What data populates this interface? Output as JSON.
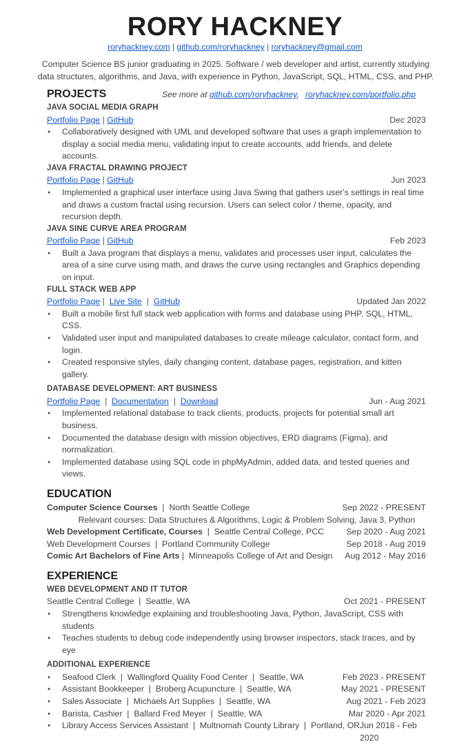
{
  "header": {
    "name": "RORY HACKNEY",
    "links": [
      "roryhackney.com",
      "github.com/roryhackney",
      "roryhackney@gmail.com"
    ],
    "separator": "|",
    "summary_line1": "Computer Science BS junior graduating in 2025. Software / web developer and artist, currently studying",
    "summary_line2": "data structures, algorithms, and Java, with experience in Python, JavaScript, SQL, HTML, CSS, and PHP."
  },
  "projects": {
    "title": "PROJECTS",
    "see_more_label": "See more at",
    "see_more_links": [
      "github.com/roryhackney",
      "roryhackney.com/portfolio.php"
    ],
    "items": [
      {
        "title": "JAVA SOCIAL MEDIA GRAPH",
        "links": [
          "Portfolio Page",
          "GitHub"
        ],
        "date": "Dec 2023",
        "bullets": [
          "Collaboratively designed with UML and developed software that uses a graph implementation to display a social media menu, validating input to create accounts, add friends, and delete accounts."
        ]
      },
      {
        "title": "JAVA FRACTAL DRAWING PROJECT",
        "links": [
          "Portfolio Page",
          "GitHub"
        ],
        "date": "Jun 2023",
        "bullets": [
          "Implemented a graphical user interface using Java Swing that gathers user's settings in real time and draws a custom fractal using recursion. Users can select color / theme, opacity, and recursion depth."
        ]
      },
      {
        "title": "JAVA SINE CURVE AREA PROGRAM",
        "links": [
          "Portfolio Page",
          "GitHub"
        ],
        "date": "Feb 2023",
        "bullets": [
          "Built a Java program that displays a menu, validates and processes user input, calculates the area of a sine curve using math, and draws the curve using rectangles and Graphics depending on input."
        ]
      },
      {
        "title": "FULL STACK WEB APP",
        "links": [
          "Portfolio Page",
          "Live Site",
          "GitHub"
        ],
        "date": "Updated Jan 2022",
        "bullets": [
          "Built a mobile first full stack web application with forms and database using PHP, SQL, HTML, CSS.",
          "Validated user input and manipulated databases to create mileage calculator, contact form, and login.",
          "Created responsive styles, daily changing content, database pages, registration, and kitten gallery."
        ]
      },
      {
        "title": "DATABASE DEVELOPMENT: ART BUSINESS",
        "links": [
          "Portfolio Page",
          "Documentation",
          "Download"
        ],
        "date": "Jun - Aug 2021",
        "bullets": [
          "Implemented relational database to track clients, products, projects for potential small art business.",
          "Documented the database design with mission objectives, ERD diagrams (Figma), and normalization.",
          "Implemented database using SQL code in phpMyAdmin, added data, and tested queries and views."
        ]
      }
    ]
  },
  "education": {
    "title": "EDUCATION",
    "items": [
      {
        "program": "Computer Science Courses",
        "school": "North Seattle College",
        "date": "Sep 2022 - PRESENT",
        "bold": true
      },
      {
        "sub": "Relevant courses: Data Structures & Algorithms, Logic & Problem Solving, Java 3, Python"
      },
      {
        "program": "Web Development Certificate, Courses",
        "school": "Seattle Central College, PCC",
        "date": "Sep 2020 - Aug 2021",
        "bold": true
      },
      {
        "program": "Web Development Courses",
        "school": "Portland Community College",
        "date": "Sep 2018 - Aug 2019",
        "bold": false
      },
      {
        "program": "Comic Art Bachelors of Fine Arts",
        "school": "Minneapolis College of Art and Design",
        "date": "Aug 2012 - May 2016",
        "bold": true
      }
    ]
  },
  "experience": {
    "title": "EXPERIENCE",
    "main": {
      "title": "WEB DEVELOPMENT AND IT TUTOR",
      "place": "Seattle Central College",
      "location": "Seattle, WA",
      "date": "Oct 2021 - PRESENT",
      "bullets": [
        "Strengthens knowledge explaining and troubleshooting Java, Python, JavaScript, CSS with students",
        "Teaches students to debug code independently using browser inspectors, stack traces, and by eye"
      ]
    },
    "additional_title": "ADDITIONAL EXPERIENCE",
    "additional": [
      {
        "text": "Seafood Clerk  |  Wallingford Quality Food Center  |  Seattle, WA",
        "date": "Feb 2023 - PRESENT"
      },
      {
        "text": "Assistant Bookkeeper  |  Broberg Acupuncture  |  Seattle, WA",
        "date": "May 2021 - PRESENT"
      },
      {
        "text": "Sales Associate  |  Michaels Art Supplies  |  Seattle, WA",
        "date": "Aug 2021 - Feb 2023"
      },
      {
        "text": "Barista, Cashier  |  Ballard Fred Meyer  |  Seattle, WA",
        "date": "Mar 2020 - Apr 2021"
      },
      {
        "text": "Library Access Services Assistant  |  Multnomah County Library  |  Portland, OR",
        "date": "Jun 2018 - Feb 2020"
      }
    ]
  },
  "colors": {
    "link": "#1155cc",
    "text": "#434343",
    "heading": "#1f1f1f"
  }
}
